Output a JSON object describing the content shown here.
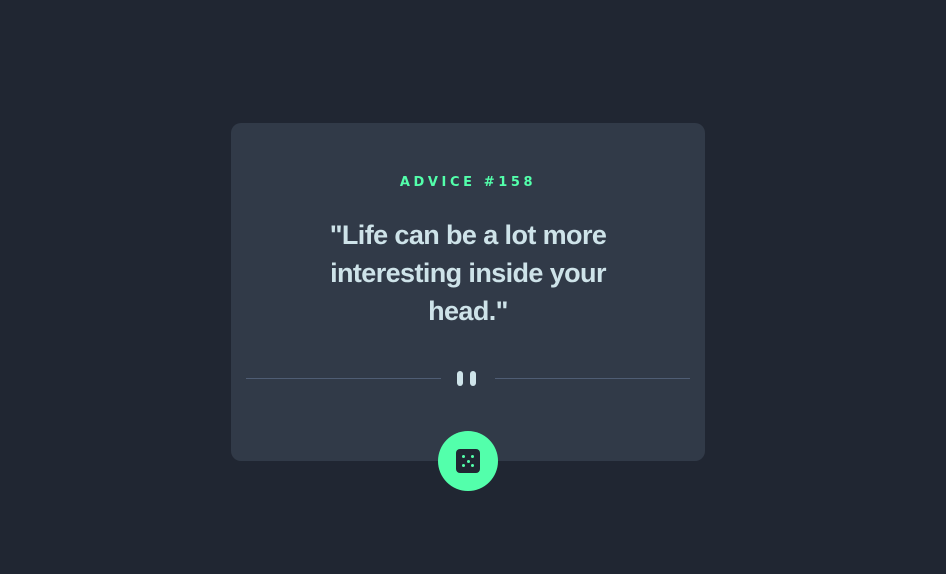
{
  "advice": {
    "label": "ADVICE #158",
    "text": "\"Life can be a lot more interesting inside your head.\""
  },
  "icons": {
    "divider": "pause-icon",
    "button": "dice-icon"
  },
  "colors": {
    "background": "#202632",
    "card": "#313a48",
    "accent": "#53ffab",
    "text": "#cee3e9",
    "divider": "#4f5d74"
  }
}
